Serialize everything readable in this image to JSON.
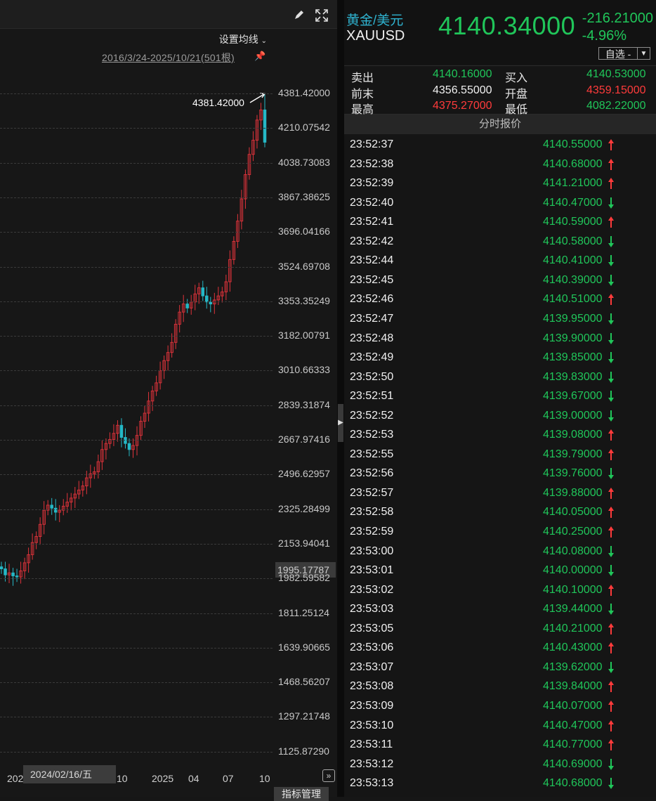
{
  "chart_panel": {
    "tools": {
      "draw_icon": "pencil-icon",
      "fullscreen_icon": "expand-icon"
    },
    "ma_setting_label": "设置均线",
    "range_label": "2016/3/24-2025/10/21(501根)",
    "max_label": "4381.42000",
    "current_price_tag": "1995.17787",
    "y_axis_labels": [
      "4381.42000",
      "4210.07542",
      "4038.73083",
      "3867.38625",
      "3696.04166",
      "3524.69708",
      "3353.35249",
      "3182.00791",
      "3010.66333",
      "2839.31874",
      "2667.97416",
      "2496.62957",
      "2325.28499",
      "2153.94041",
      "1982.59582",
      "1811.25124",
      "1639.90665",
      "1468.56207",
      "1297.21748",
      "1125.87290"
    ],
    "x_axis_labels": [
      "202",
      "10",
      "2025",
      "04",
      "07",
      "10"
    ],
    "date_tooltip": "2024/02/16/五",
    "indicator_button": "指标管理",
    "up_color": "#e0333b",
    "down_color": "#25b8c6"
  },
  "chart_data": {
    "type": "candlestick",
    "ylim": [
      1125.8729,
      4381.42
    ],
    "max_value": 4381.42,
    "x_ticks": [
      "202",
      "10",
      "2025",
      "04",
      "07",
      "10"
    ],
    "close_approx": [
      2030,
      2000,
      2010,
      1995,
      1990,
      2020,
      2060,
      2100,
      2160,
      2190,
      2250,
      2320,
      2345,
      2330,
      2310,
      2320,
      2340,
      2360,
      2380,
      2400,
      2420,
      2440,
      2480,
      2500,
      2510,
      2560,
      2620,
      2650,
      2670,
      2700,
      2740,
      2680,
      2650,
      2620,
      2640,
      2690,
      2760,
      2800,
      2860,
      2910,
      2950,
      3010,
      3060,
      3100,
      3150,
      3240,
      3300,
      3340,
      3320,
      3350,
      3390,
      3420,
      3380,
      3350,
      3340,
      3360,
      3380,
      3400,
      3450,
      3560,
      3650,
      3750,
      3860,
      3980,
      4080,
      4150,
      4250,
      4300,
      4140
    ]
  },
  "quote_panel": {
    "name": "黄金/美元",
    "code": "XAUUSD",
    "last_price": "4140.34000",
    "change": "-216.21000",
    "change_pct": "-4.96%",
    "watchlist_button": "自选 -",
    "book": {
      "sell_label": "卖出",
      "sell_value": "4140.16000",
      "buy_label": "买入",
      "buy_value": "4140.53000",
      "prev_close_label": "前末",
      "prev_close_value": "4356.55000",
      "open_label": "开盘",
      "open_value": "4359.15000",
      "high_label": "最高",
      "high_value": "4375.27000",
      "low_label": "最低",
      "low_value": "4082.22000"
    },
    "colors": {
      "up": "#ff3b3b",
      "down": "#20c65a",
      "neutral": "#f0f0f0"
    },
    "ticks_title": "分时报价",
    "ticks": [
      {
        "time": "23:52:37",
        "price": "4140.55000",
        "dir": "up"
      },
      {
        "time": "23:52:38",
        "price": "4140.68000",
        "dir": "up"
      },
      {
        "time": "23:52:39",
        "price": "4141.21000",
        "dir": "up"
      },
      {
        "time": "23:52:40",
        "price": "4140.47000",
        "dir": "down"
      },
      {
        "time": "23:52:41",
        "price": "4140.59000",
        "dir": "up"
      },
      {
        "time": "23:52:42",
        "price": "4140.58000",
        "dir": "down"
      },
      {
        "time": "23:52:44",
        "price": "4140.41000",
        "dir": "down"
      },
      {
        "time": "23:52:45",
        "price": "4140.39000",
        "dir": "down"
      },
      {
        "time": "23:52:46",
        "price": "4140.51000",
        "dir": "up"
      },
      {
        "time": "23:52:47",
        "price": "4139.95000",
        "dir": "down"
      },
      {
        "time": "23:52:48",
        "price": "4139.90000",
        "dir": "down"
      },
      {
        "time": "23:52:49",
        "price": "4139.85000",
        "dir": "down"
      },
      {
        "time": "23:52:50",
        "price": "4139.83000",
        "dir": "down"
      },
      {
        "time": "23:52:51",
        "price": "4139.67000",
        "dir": "down"
      },
      {
        "time": "23:52:52",
        "price": "4139.00000",
        "dir": "down"
      },
      {
        "time": "23:52:53",
        "price": "4139.08000",
        "dir": "up"
      },
      {
        "time": "23:52:55",
        "price": "4139.79000",
        "dir": "up"
      },
      {
        "time": "23:52:56",
        "price": "4139.76000",
        "dir": "down"
      },
      {
        "time": "23:52:57",
        "price": "4139.88000",
        "dir": "up"
      },
      {
        "time": "23:52:58",
        "price": "4140.05000",
        "dir": "up"
      },
      {
        "time": "23:52:59",
        "price": "4140.25000",
        "dir": "up"
      },
      {
        "time": "23:53:00",
        "price": "4140.08000",
        "dir": "down"
      },
      {
        "time": "23:53:01",
        "price": "4140.00000",
        "dir": "down"
      },
      {
        "time": "23:53:02",
        "price": "4140.10000",
        "dir": "up"
      },
      {
        "time": "23:53:03",
        "price": "4139.44000",
        "dir": "down"
      },
      {
        "time": "23:53:05",
        "price": "4140.21000",
        "dir": "up"
      },
      {
        "time": "23:53:06",
        "price": "4140.43000",
        "dir": "up"
      },
      {
        "time": "23:53:07",
        "price": "4139.62000",
        "dir": "down"
      },
      {
        "time": "23:53:08",
        "price": "4139.84000",
        "dir": "up"
      },
      {
        "time": "23:53:09",
        "price": "4140.07000",
        "dir": "up"
      },
      {
        "time": "23:53:10",
        "price": "4140.47000",
        "dir": "up"
      },
      {
        "time": "23:53:11",
        "price": "4140.77000",
        "dir": "up"
      },
      {
        "time": "23:53:12",
        "price": "4140.69000",
        "dir": "down"
      },
      {
        "time": "23:53:13",
        "price": "4140.68000",
        "dir": "down"
      }
    ]
  }
}
